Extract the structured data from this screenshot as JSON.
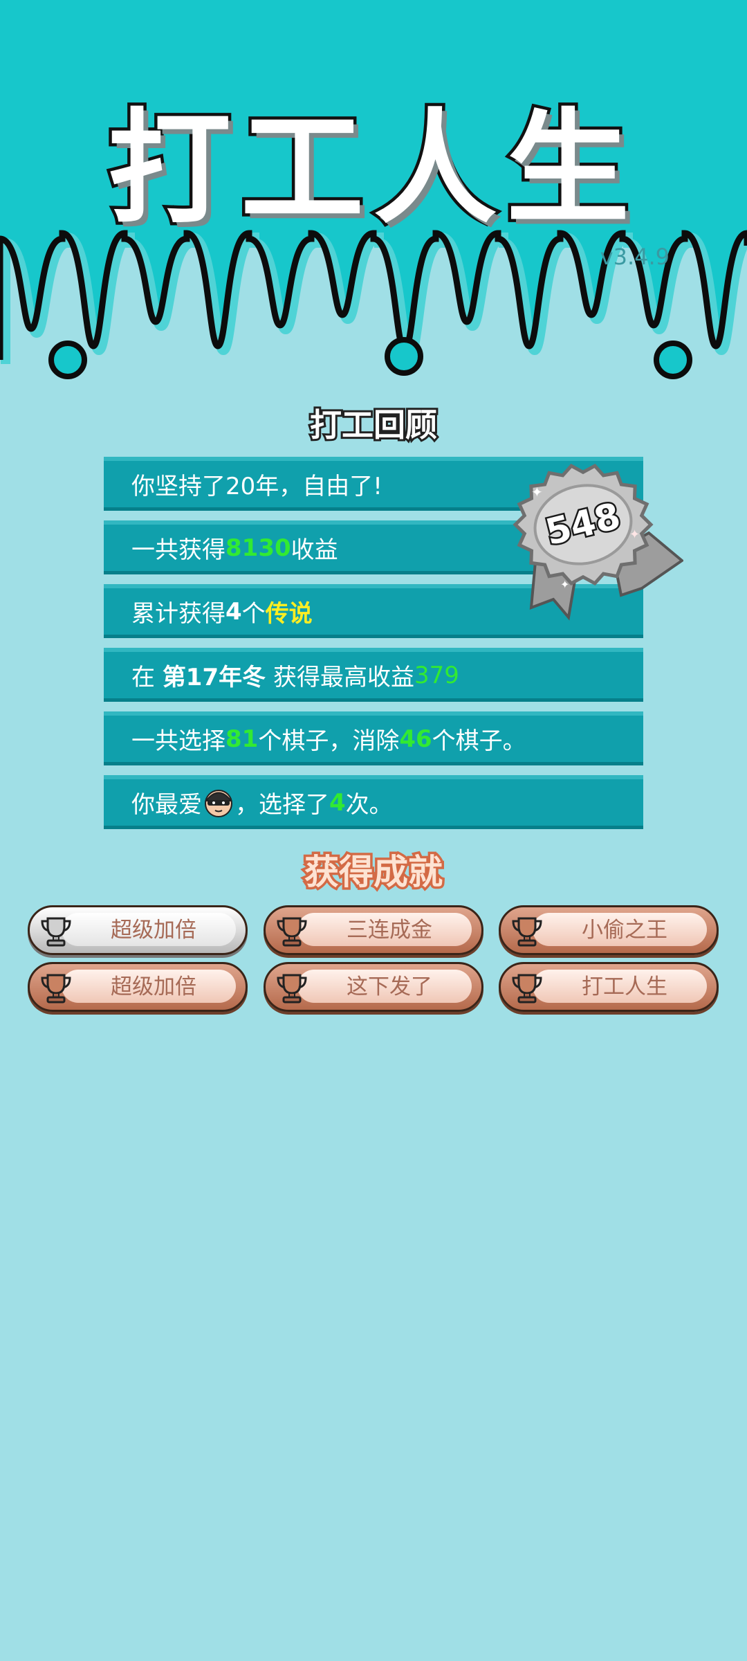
{
  "header": {
    "title": "打工人生",
    "version": "v3.4.9"
  },
  "review": {
    "title": "打工回顾",
    "medal_score": "548",
    "rows": [
      {
        "pre": "你坚持了20年，自由了!"
      },
      {
        "pre": "一共获得",
        "value": "8130",
        "post": "收益"
      },
      {
        "pre": "累计获得",
        "count": "4",
        "mid": "个",
        "rarity": "传说"
      },
      {
        "pre": "在 ",
        "period": "第17年冬",
        "mid": " 获得最高收益",
        "value": "379"
      },
      {
        "pre": "一共选择",
        "chosen": "81",
        "mid": "个棋子，消除",
        "removed": "46",
        "post": "个棋子。"
      },
      {
        "pre": "你最爱",
        "mid": "，选择了",
        "times": "4",
        "post": "次。",
        "icon": "thief-face-icon"
      }
    ]
  },
  "achievements": {
    "title": "获得成就",
    "items": [
      {
        "label": "超级加倍",
        "tier": "silver"
      },
      {
        "label": "三连成金",
        "tier": "bronze"
      },
      {
        "label": "小偷之王",
        "tier": "bronze"
      },
      {
        "label": "超级加倍",
        "tier": "bronze"
      },
      {
        "label": "这下发了",
        "tier": "bronze"
      },
      {
        "label": "打工人生",
        "tier": "bronze"
      }
    ]
  },
  "colors": {
    "header_bg": "#17c7cb",
    "page_bg": "#a0dfe6",
    "row_bg": "#10a0ac",
    "highlight_green": "#32ea32",
    "highlight_yellow": "#ffee22",
    "bronze": "#c17a5c",
    "silver": "#d2d2d2"
  }
}
